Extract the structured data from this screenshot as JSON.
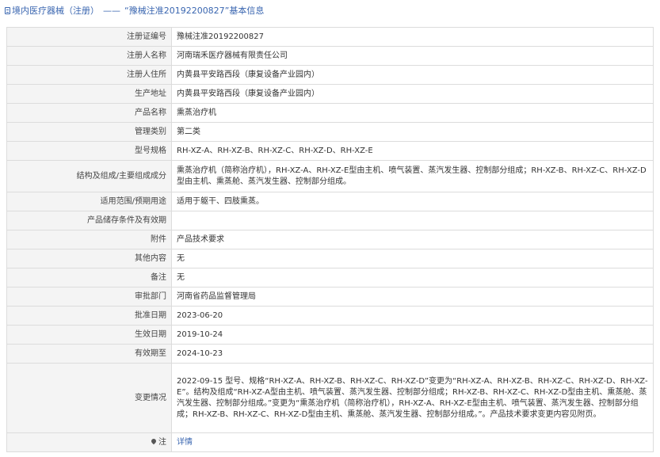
{
  "header": {
    "title_prefix": "境内医疗器械（注册）",
    "separator": "——",
    "title_main": "“豫械注准20192200827”基本信息"
  },
  "rows": [
    {
      "label": "注册证编号",
      "value": "豫械注准20192200827"
    },
    {
      "label": "注册人名称",
      "value": "河南瑞禾医疗器械有限责任公司"
    },
    {
      "label": "注册人住所",
      "value": "内黄县平安路西段（康复设备产业园内）"
    },
    {
      "label": "生产地址",
      "value": "内黄县平安路西段（康复设备产业园内）"
    },
    {
      "label": "产品名称",
      "value": "熏蒸治疗机"
    },
    {
      "label": "管理类别",
      "value": "第二类"
    },
    {
      "label": "型号规格",
      "value": "RH-XZ-A、RH-XZ-B、RH-XZ-C、RH-XZ-D、RH-XZ-E"
    },
    {
      "label": "结构及组成/主要组成成分",
      "value": "熏蒸治疗机（简称治疗机），RH-XZ-A、RH-XZ-E型由主机、喷气装置、蒸汽发生器、控制部分组成；RH-XZ-B、RH-XZ-C、RH-XZ-D型由主机、熏蒸舱、蒸汽发生器、控制部分组成。"
    },
    {
      "label": "适用范围/预期用途",
      "value": "适用于躯干、四肢熏蒸。"
    },
    {
      "label": "产品储存条件及有效期",
      "value": ""
    },
    {
      "label": "附件",
      "value": "产品技术要求"
    },
    {
      "label": "其他内容",
      "value": "无"
    },
    {
      "label": "备注",
      "value": "无"
    },
    {
      "label": "审批部门",
      "value": "河南省药品监督管理局"
    },
    {
      "label": "批准日期",
      "value": "2023-06-20"
    },
    {
      "label": "生效日期",
      "value": "2019-10-24"
    },
    {
      "label": "有效期至",
      "value": "2024-10-23"
    },
    {
      "label": "变更情况",
      "value": "2022-09-15 型号、规格“RH-XZ-A、RH-XZ-B、RH-XZ-C、RH-XZ-D”变更为“RH-XZ-A、RH-XZ-B、RH-XZ-C、RH-XZ-D、RH-XZ-E”。结构及组成“RH-XZ-A型由主机、喷气装置、蒸汽发生器、控制部分组成；RH-XZ-B、RH-XZ-C、RH-XZ-D型由主机、熏蒸舱、蒸汽发生器、控制部分组成。”变更为“熏蒸治疗机（简称治疗机），RH-XZ-A、RH-XZ-E型由主机、喷气装置、蒸汽发生器、控制部分组成；RH-XZ-B、RH-XZ-C、RH-XZ-D型由主机、熏蒸舱、蒸汽发生器、控制部分组成。”。产品技术要求变更内容见附页。"
    },
    {
      "label": "注",
      "value": "详情"
    }
  ],
  "icons": {
    "header": "document-icon",
    "note": "location-pin-icon"
  },
  "colors": {
    "link": "#3a66b0",
    "label_bg": "#f4f4f4",
    "border": "#dcdcdc"
  }
}
